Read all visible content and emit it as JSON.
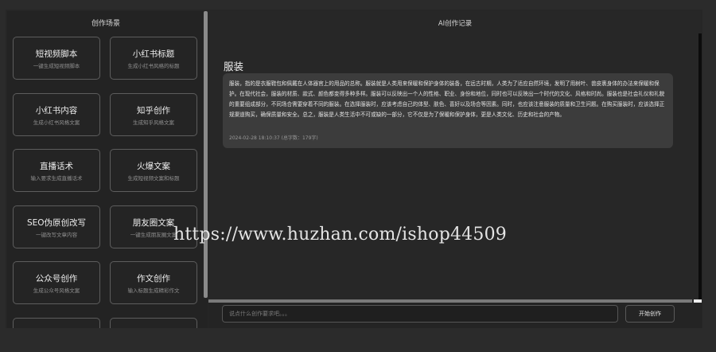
{
  "left": {
    "title": "创作场景",
    "cards": [
      {
        "title": "短视频脚本",
        "sub": "一键生成短视频脚本"
      },
      {
        "title": "小红书标题",
        "sub": "生成小红书风格的标题"
      },
      {
        "title": "小红书内容",
        "sub": "生成小红书风格文案"
      },
      {
        "title": "知乎创作",
        "sub": "生成知乎风格文案"
      },
      {
        "title": "直播话术",
        "sub": "输入要求生成直播话术"
      },
      {
        "title": "火爆文案",
        "sub": "生成短视频文案和标题"
      },
      {
        "title": "SEO伪原创改写",
        "sub": "一键改写文章内容"
      },
      {
        "title": "朋友圈文案",
        "sub": "一键生成朋友圈文案"
      },
      {
        "title": "公众号创作",
        "sub": "生成公众号风格文案"
      },
      {
        "title": "作文创作",
        "sub": "输入标题生成精彩作文"
      },
      {
        "title": "",
        "sub": ""
      },
      {
        "title": "",
        "sub": ""
      }
    ]
  },
  "right": {
    "title": "AI创作记录",
    "record": {
      "title": "服装",
      "text": "服装，指的是衣服鞋包和佩戴在人体器官上的用品的总称。服装就是人类用来保暖和保护身体的装备，在远古时期，人类为了适应自然环境，发明了用树叶、兽皮裹身体的办法来保暖和保护。在现代社会，服装的材质、款式、颜色都变得多种多样。服装可以反映出一个人的性格、职业、身份和地位，同时也可以反映出一个时代的文化、风格和时尚。服装也是社会礼仪和礼貌的重要组成部分，不同场合需要穿着不同的服装。在选择服装时，应该考虑自己的体型、肤色、喜好以及场合等因素。同时，也应该注意服装的质量和卫生问题。在购买服装时，应该选择正规渠道购买，确保质量和安全。总之，服装是人类生活中不可或缺的一部分，它不仅是为了保暖和保护身体，更是人类文化、历史和社会的产物。",
      "meta": "2024-02-28 18:10:37  (总字数：179字)"
    }
  },
  "input": {
    "placeholder": "说点什么创作要求吧。。。",
    "value": "",
    "send_label": "开始创作"
  },
  "watermark": "https://www.huzhan.com/ishop44509"
}
